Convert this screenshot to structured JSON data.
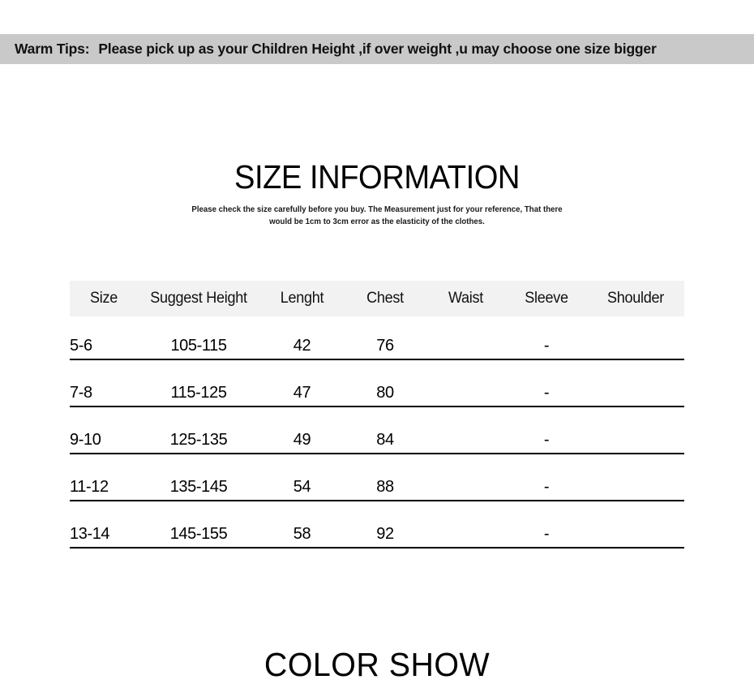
{
  "banner": {
    "label": "Warm Tips:",
    "message": "Please pick up as your Children Height ,if over weight ,u may choose one size bigger",
    "background_color": "#c9c9c9",
    "text_color": "#111111"
  },
  "size_section": {
    "title": "SIZE INFORMATION",
    "subtitle": "Please check the size carefully before you buy. The Measurement just for your reference, That there would be 1cm to 3cm error as the elasticity of the clothes."
  },
  "table": {
    "header_background": "#f2f2f2",
    "line_color": "#000000",
    "columns": [
      "Size",
      "Suggest Height",
      "Lenght",
      "Chest",
      "Waist",
      "Sleeve",
      "Shoulder"
    ],
    "rows": [
      {
        "size": "5-6",
        "suggest_height": "105-115",
        "lenght": "42",
        "chest": "76",
        "waist": "",
        "sleeve": "-",
        "shoulder": ""
      },
      {
        "size": "7-8",
        "suggest_height": "115-125",
        "lenght": "47",
        "chest": "80",
        "waist": "",
        "sleeve": "-",
        "shoulder": ""
      },
      {
        "size": "9-10",
        "suggest_height": "125-135",
        "lenght": "49",
        "chest": "84",
        "waist": "",
        "sleeve": "-",
        "shoulder": ""
      },
      {
        "size": "11-12",
        "suggest_height": "135-145",
        "lenght": "54",
        "chest": "88",
        "waist": "",
        "sleeve": "-",
        "shoulder": ""
      },
      {
        "size": "13-14",
        "suggest_height": "145-155",
        "lenght": "58",
        "chest": "92",
        "waist": "",
        "sleeve": "-",
        "shoulder": ""
      }
    ]
  },
  "color_section": {
    "title": "COLOR SHOW"
  }
}
